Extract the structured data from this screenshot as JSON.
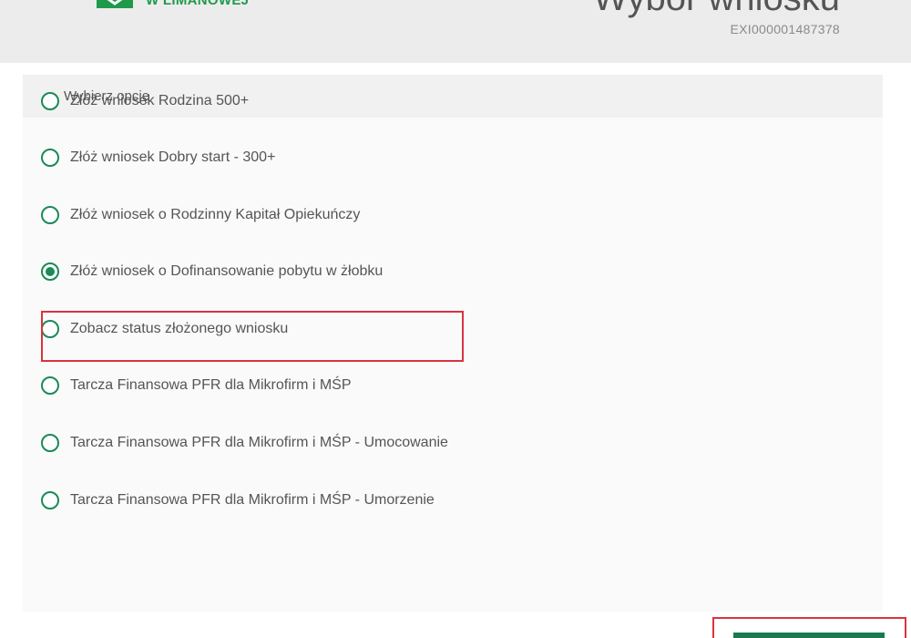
{
  "header": {
    "logo_icon": "envelope-logo-icon",
    "logo_text": "W LIMANOWEJ",
    "title": "Wybór wniosku",
    "reference": "EXI000001487378"
  },
  "panel": {
    "header_label": "Wybierz opcję",
    "options": [
      {
        "label": "Złóż wniosek Rodzina 500+",
        "selected": false
      },
      {
        "label": "Złóż wniosek Dobry start - 300+",
        "selected": false
      },
      {
        "label": "Złóż wniosek o Rodzinny Kapitał Opiekuńczy",
        "selected": false
      },
      {
        "label": "Złóż wniosek o Dofinansowanie pobytu w żłobku",
        "selected": true
      },
      {
        "label": "Zobacz status złożonego wniosku",
        "selected": false
      },
      {
        "label": "Tarcza Finansowa PFR dla Mikrofirm i MŚP",
        "selected": false
      },
      {
        "label": "Tarcza Finansowa PFR dla Mikrofirm i MŚP - Umocowanie",
        "selected": false
      },
      {
        "label": "Tarcza Finansowa PFR dla Mikrofirm i MŚP - Umorzenie",
        "selected": false
      }
    ]
  },
  "submit": {
    "label": ""
  },
  "colors": {
    "accent": "#1a8a57",
    "highlight": "#d93340",
    "header_bg": "#ececec"
  }
}
